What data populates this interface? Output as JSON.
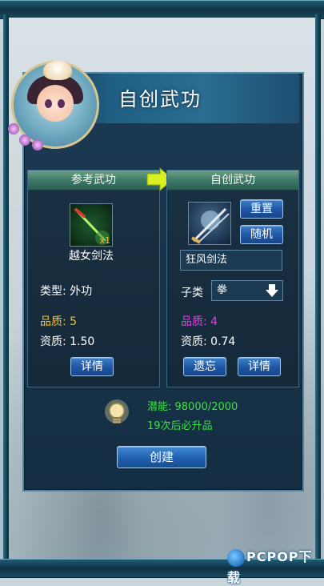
{
  "header": {
    "title": "自创武功"
  },
  "reference": {
    "heading": "参考武功",
    "skill_name": "越女剑法",
    "count_badge": "x1",
    "type_text": "类型: 外功",
    "quality_text": "品质: 5",
    "aptitude_text": "资质: 1.50",
    "detail_button": "详情"
  },
  "custom": {
    "heading": "自创武功",
    "reset_button": "重置",
    "random_button": "随机",
    "name_value": "狂风剑法",
    "subtype_label": "子类",
    "subtype_value": "拳",
    "quality_text": "品质: 4",
    "aptitude_text": "资质: 0.74",
    "forget_button": "遗忘",
    "detail_button": "详情"
  },
  "potential": {
    "label": "潜能: 98000/2000",
    "upgrade_count": "19",
    "upgrade_mid": "次后必",
    "upgrade_word": "升品"
  },
  "actions": {
    "create_button": "创建"
  },
  "watermark": {
    "text": "PCPOP下载"
  },
  "colors": {
    "quality_reference": "#f0c030",
    "quality_custom": "#e040e0",
    "potential_green": "#3fe048",
    "arrow_yellow": "#d8f020"
  },
  "icons": {
    "avatar": "girl-portrait-with-pet",
    "reference_skill": "green-sword-skill-icon",
    "custom_skill": "crossed-swords-frost-icon",
    "arrow": "right-arrow-icon",
    "dropdown": "down-arrow-icon",
    "hint": "lightbulb-icon"
  }
}
